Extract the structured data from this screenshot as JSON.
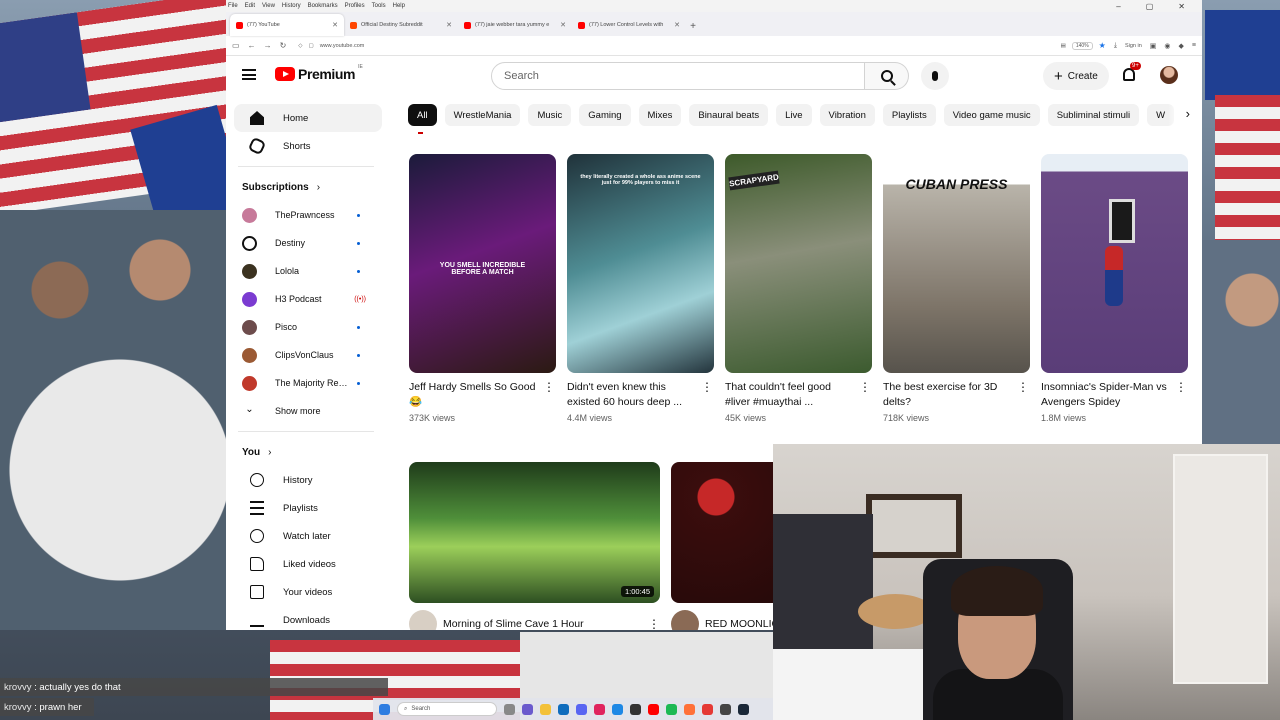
{
  "browser": {
    "menu": [
      "File",
      "Edit",
      "View",
      "History",
      "Bookmarks",
      "Profiles",
      "Tools",
      "Help"
    ],
    "tabs": [
      {
        "title": "(77) YouTube",
        "color": "#ff0000",
        "active": true
      },
      {
        "title": "Official Destiny Subreddit",
        "color": "#ff4500",
        "active": false
      },
      {
        "title": "(77) jaie webber tara yummy e",
        "color": "#ff0000",
        "active": false
      },
      {
        "title": "(77) Lower Control Levels with",
        "color": "#ff0000",
        "active": false
      }
    ],
    "url": "www.youtube.com",
    "zoom": "140%",
    "sign_in": "Sign in"
  },
  "youtube": {
    "logo_text": "Premium",
    "logo_sup": "IE",
    "search_placeholder": "Search",
    "create_label": "Create",
    "notif_badge": "9+",
    "sidebar": {
      "main": [
        {
          "label": "Home",
          "icon": "home-icon",
          "active": true
        },
        {
          "label": "Shorts",
          "icon": "shorts-icon",
          "active": false
        }
      ],
      "subscriptions_title": "Subscriptions",
      "subscriptions": [
        {
          "name": "ThePrawncess",
          "color": "#c77a9a",
          "status": "dot"
        },
        {
          "name": "Destiny",
          "color": "#ffffff",
          "status": "dot"
        },
        {
          "name": "Lolola",
          "color": "#3b3220",
          "status": "dot"
        },
        {
          "name": "H3 Podcast",
          "color": "#7b3bd1",
          "status": "live"
        },
        {
          "name": "Pisco",
          "color": "#6d4c4c",
          "status": "dot"
        },
        {
          "name": "ClipsVonClaus",
          "color": "#9b5a34",
          "status": "dot"
        },
        {
          "name": "The Majority Rep...",
          "color": "#c0392b",
          "status": "dot"
        }
      ],
      "show_more": "Show more",
      "you_title": "You",
      "you_items": [
        {
          "label": "History",
          "icon": "history-icon"
        },
        {
          "label": "Playlists",
          "icon": "playlists-icon"
        },
        {
          "label": "Watch later",
          "icon": "watch-later-icon"
        },
        {
          "label": "Liked videos",
          "icon": "liked-videos-icon"
        },
        {
          "label": "Your videos",
          "icon": "your-videos-icon"
        },
        {
          "label": "Downloads",
          "icon": "downloads-icon"
        }
      ]
    },
    "chips": [
      "All",
      "WrestleMania",
      "Music",
      "Gaming",
      "Mixes",
      "Binaural beats",
      "Live",
      "Vibration",
      "Playlists",
      "Video game music",
      "Subliminal stimuli",
      "W"
    ],
    "shorts": [
      {
        "title": "Jeff Hardy Smells So Good 😂",
        "views": "373K views",
        "overlay": "YOU SMELL INCREDIBLE BEFORE A MATCH",
        "bg": "linear-gradient(160deg,#1b1b3a 0%,#6a1b7a 45%,#2b1a12 100%)"
      },
      {
        "title": "Didn't even knew this existed 60 hours deep ...",
        "views": "4.4M views",
        "overlay": "they literally created a whole ass anime scene just for 99% players to miss it",
        "bg": "linear-gradient(160deg,#20323a 0%,#4f8d94 45%,#9fd0d6 70%,#23343c 100%)"
      },
      {
        "title": "That couldn't feel good #liver #muaythai ...",
        "views": "45K views",
        "overlay": "SCRAPYARD",
        "bg": "linear-gradient(170deg,#3d5a2a 0%,#8a8f7a 45%,#3c5b2f 100%)"
      },
      {
        "title": "The best exercise for 3D delts?",
        "views": "718K views",
        "overlay": "CUBAN PRESS",
        "bg": "linear-gradient(180deg,#ffffff 0 14%,#b9b4aa 14%,#7d7468 70%,#57534c 100%)"
      },
      {
        "title": "Insomniac's Spider-Man vs Avengers Spidey",
        "views": "1.8M views",
        "overlay": "",
        "bg": "linear-gradient(180deg,#e7eef5 0 8%,#6b4b86 8%,#5a3d78 100%)"
      }
    ],
    "videos": [
      {
        "title": "Morning of Slime Cave 1 Hour",
        "duration": "1:00:45",
        "bg": "linear-gradient(180deg,#1f3b1a 0%,#4f8f3a 40%,#9ccf5a 60%,#2d4f22 100%)",
        "avatar": "#d8cfc4"
      },
      {
        "title": "RED MOONLIGHT",
        "duration": "",
        "bg": "radial-gradient(circle at 45% 30%,#c62828 0 18px,#3a0d0d 19px,#120606 100%)",
        "avatar": "#8a6a55"
      }
    ]
  },
  "chat": [
    {
      "user": "krovvy",
      "message": "actually yes do that"
    },
    {
      "user": "krovvy",
      "message": "prawn her"
    }
  ],
  "taskbar": {
    "search_label": "Search"
  }
}
